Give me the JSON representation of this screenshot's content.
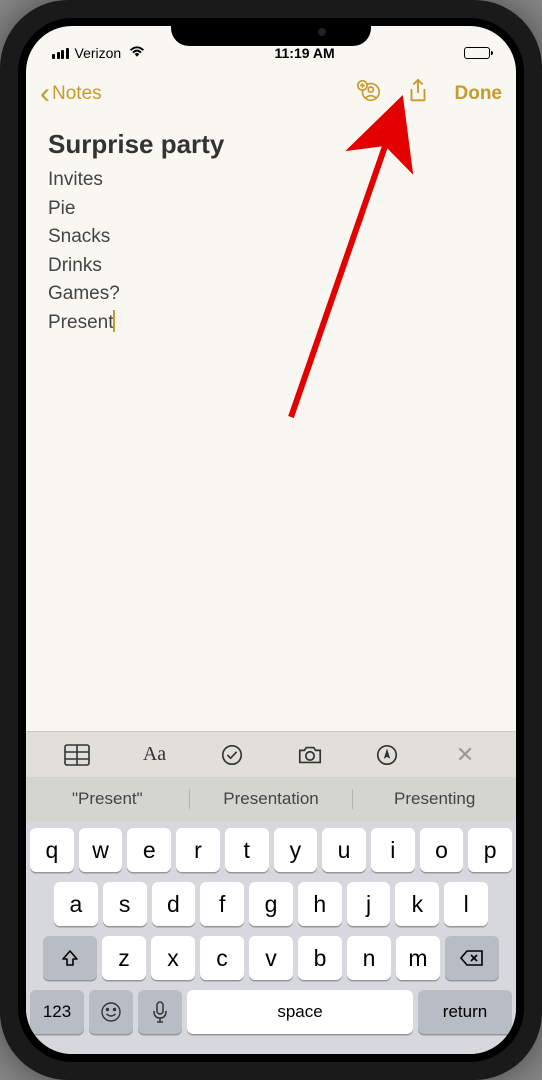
{
  "statusbar": {
    "carrier": "Verizon",
    "time": "11:19 AM"
  },
  "nav": {
    "back_label": "Notes",
    "done_label": "Done"
  },
  "note": {
    "title": "Surprise party",
    "lines": [
      "Invites",
      "Pie",
      "Snacks",
      "Drinks",
      "Games?",
      "Present"
    ]
  },
  "suggestions": [
    "\"Present\"",
    "Presentation",
    "Presenting"
  ],
  "keyboard": {
    "row1": [
      "q",
      "w",
      "e",
      "r",
      "t",
      "y",
      "u",
      "i",
      "o",
      "p"
    ],
    "row2": [
      "a",
      "s",
      "d",
      "f",
      "g",
      "h",
      "j",
      "k",
      "l"
    ],
    "row3": [
      "z",
      "x",
      "c",
      "v",
      "b",
      "n",
      "m"
    ],
    "shift_label": "",
    "num_label": "123",
    "space_label": "space",
    "return_label": "return"
  },
  "colors": {
    "accent": "#c69a2d"
  }
}
